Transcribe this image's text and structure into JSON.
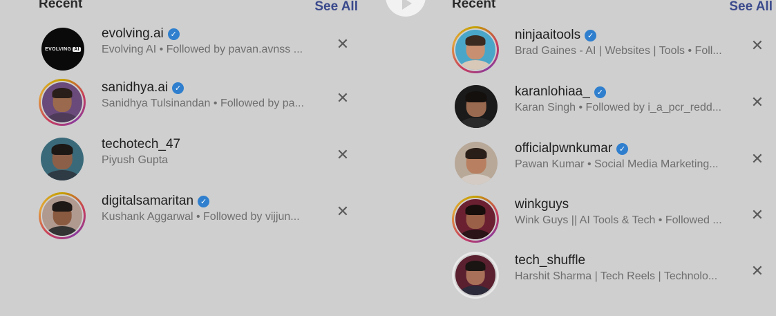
{
  "left": {
    "title": "Recent",
    "see_all": "See All",
    "items": [
      {
        "username": "evolving.ai",
        "verified": true,
        "subtitle": "Evolving AI • Followed by pavan.avnss ...",
        "logo_text": "EVOLVING",
        "logo_badge": "AI"
      },
      {
        "username": "sanidhya.ai",
        "verified": true,
        "subtitle": "Sanidhya Tulsinandan • Followed by pa..."
      },
      {
        "username": "techotech_47",
        "verified": false,
        "subtitle": "Piyush Gupta"
      },
      {
        "username": "digitalsamaritan",
        "verified": true,
        "subtitle": "Kushank Aggarwal • Followed by vijjun..."
      }
    ]
  },
  "right": {
    "title": "Recent",
    "see_all": "See All",
    "items": [
      {
        "username": "ninjaaitools",
        "verified": true,
        "subtitle": "Brad Gaines - AI | Websites | Tools • Foll..."
      },
      {
        "username": "karanlohiaa_",
        "verified": true,
        "subtitle": "Karan Singh • Followed by i_a_pcr_redd..."
      },
      {
        "username": "officialpwnkumar",
        "verified": true,
        "subtitle": "Pawan Kumar • Social Media Marketing..."
      },
      {
        "username": "winkguys",
        "verified": false,
        "subtitle": "Wink Guys || AI Tools & Tech • Followed ..."
      },
      {
        "username": "tech_shuffle",
        "verified": false,
        "subtitle": "Harshit Sharma | Tech Reels | Technolo..."
      }
    ]
  },
  "icons": {
    "verified": "verified-badge-icon",
    "close": "close-icon",
    "play": "play-icon"
  },
  "colors": {
    "background": "#cfcfcf",
    "link": "#3a4a8c",
    "verified": "#2f7fce"
  }
}
